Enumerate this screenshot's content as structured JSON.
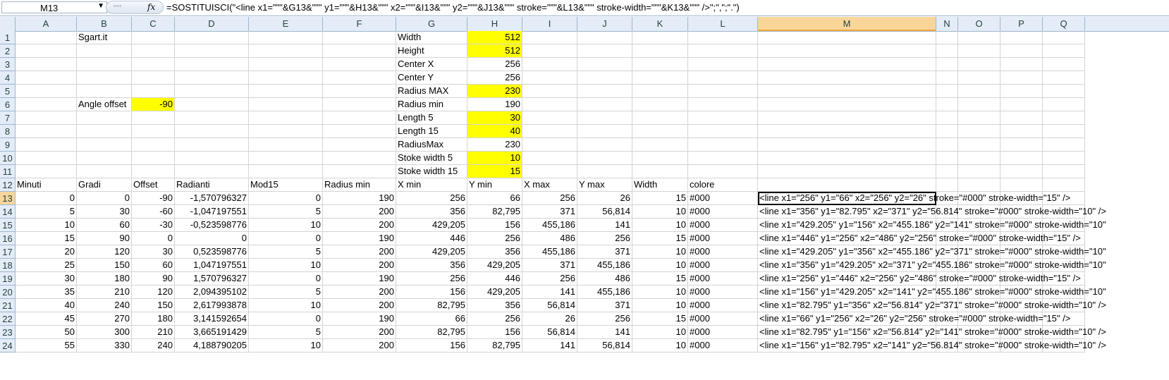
{
  "formula_bar": {
    "namebox": "M13",
    "fx": "fx",
    "formula": "=SOSTITUISCI(\"<line x1=\"\"\"&G13&\"\"\" y1=\"\"\"&H13&\"\"\" x2=\"\"\"&I13&\"\"\" y2=\"\"\"&J13&\"\"\" stroke=\"\"\"&L13&\"\"\" stroke-width=\"\"\"&K13&\"\"\" />\";\",\";\".\")"
  },
  "columns": [
    "A",
    "B",
    "C",
    "D",
    "E",
    "F",
    "G",
    "H",
    "I",
    "J",
    "K",
    "L",
    "M",
    "N",
    "O",
    "P",
    "Q"
  ],
  "rows": [
    "1",
    "2",
    "3",
    "4",
    "5",
    "6",
    "7",
    "8",
    "9",
    "10",
    "11",
    "12",
    "13",
    "14",
    "15",
    "16",
    "17",
    "18",
    "19",
    "20",
    "21",
    "22",
    "23",
    "24"
  ],
  "params": {
    "site": "Sgart.it",
    "angle_offset_label": "Angle offset",
    "angle_offset_value": "-90",
    "labels": [
      "Width",
      "Height",
      "Center X",
      "Center Y",
      "Radius MAX",
      "Radius min",
      "Length 5",
      "Length 15",
      "RadiusMax",
      "Stoke width 5",
      "Stoke width 15"
    ],
    "values": [
      "512",
      "512",
      "256",
      "256",
      "230",
      "190",
      "30",
      "40",
      "230",
      "10",
      "15"
    ]
  },
  "table": {
    "headers": [
      "Minuti",
      "Gradi",
      "Offset",
      "Radianti",
      "Mod15",
      "Radius min",
      "X min",
      "Y min",
      "X max",
      "Y max",
      "Width",
      "colore"
    ],
    "rows": [
      [
        "0",
        "0",
        "-90",
        "-1,570796327",
        "0",
        "190",
        "256",
        "66",
        "256",
        "26",
        "15",
        "#000",
        "<line x1=\"256\" y1=\"66\" x2=\"256\" y2=\"26\" stroke=\"#000\" stroke-width=\"15\" />"
      ],
      [
        "5",
        "30",
        "-60",
        "-1,047197551",
        "5",
        "200",
        "356",
        "82,795",
        "371",
        "56,814",
        "10",
        "#000",
        "<line x1=\"356\" y1=\"82.795\" x2=\"371\" y2=\"56.814\" stroke=\"#000\" stroke-width=\"10\" />"
      ],
      [
        "10",
        "60",
        "-30",
        "-0,523598776",
        "10",
        "200",
        "429,205",
        "156",
        "455,186",
        "141",
        "10",
        "#000",
        "<line x1=\"429.205\" y1=\"156\" x2=\"455.186\" y2=\"141\" stroke=\"#000\" stroke-width=\"10\""
      ],
      [
        "15",
        "90",
        "0",
        "0",
        "0",
        "190",
        "446",
        "256",
        "486",
        "256",
        "15",
        "#000",
        "<line x1=\"446\" y1=\"256\" x2=\"486\" y2=\"256\" stroke=\"#000\" stroke-width=\"15\" />"
      ],
      [
        "20",
        "120",
        "30",
        "0,523598776",
        "5",
        "200",
        "429,205",
        "356",
        "455,186",
        "371",
        "10",
        "#000",
        "<line x1=\"429.205\" y1=\"356\" x2=\"455.186\" y2=\"371\" stroke=\"#000\" stroke-width=\"10\""
      ],
      [
        "25",
        "150",
        "60",
        "1,047197551",
        "10",
        "200",
        "356",
        "429,205",
        "371",
        "455,186",
        "10",
        "#000",
        "<line x1=\"356\" y1=\"429.205\" x2=\"371\" y2=\"455.186\" stroke=\"#000\" stroke-width=\"10\""
      ],
      [
        "30",
        "180",
        "90",
        "1,570796327",
        "0",
        "190",
        "256",
        "446",
        "256",
        "486",
        "15",
        "#000",
        "<line x1=\"256\" y1=\"446\" x2=\"256\" y2=\"486\" stroke=\"#000\" stroke-width=\"15\" />"
      ],
      [
        "35",
        "210",
        "120",
        "2,094395102",
        "5",
        "200",
        "156",
        "429,205",
        "141",
        "455,186",
        "10",
        "#000",
        "<line x1=\"156\" y1=\"429.205\" x2=\"141\" y2=\"455.186\" stroke=\"#000\" stroke-width=\"10\""
      ],
      [
        "40",
        "240",
        "150",
        "2,617993878",
        "10",
        "200",
        "82,795",
        "356",
        "56,814",
        "371",
        "10",
        "#000",
        "<line x1=\"82.795\" y1=\"356\" x2=\"56.814\" y2=\"371\" stroke=\"#000\" stroke-width=\"10\" />"
      ],
      [
        "45",
        "270",
        "180",
        "3,141592654",
        "0",
        "190",
        "66",
        "256",
        "26",
        "256",
        "15",
        "#000",
        "<line x1=\"66\" y1=\"256\" x2=\"26\" y2=\"256\" stroke=\"#000\" stroke-width=\"15\" />"
      ],
      [
        "50",
        "300",
        "210",
        "3,665191429",
        "5",
        "200",
        "82,795",
        "156",
        "56,814",
        "141",
        "10",
        "#000",
        "<line x1=\"82.795\" y1=\"156\" x2=\"56.814\" y2=\"141\" stroke=\"#000\" stroke-width=\"10\" />"
      ],
      [
        "55",
        "330",
        "240",
        "4,188790205",
        "10",
        "200",
        "156",
        "82,795",
        "141",
        "56,814",
        "10",
        "#000",
        "<line x1=\"156\" y1=\"82.795\" x2=\"141\" y2=\"56.814\" stroke=\"#000\" stroke-width=\"10\" />"
      ]
    ]
  },
  "selection": {
    "column": "M",
    "row": "13"
  },
  "colors": {
    "highlight": "#ffff00",
    "header_bg": "#e4ecf7",
    "selected_header": "#f8d69a"
  }
}
